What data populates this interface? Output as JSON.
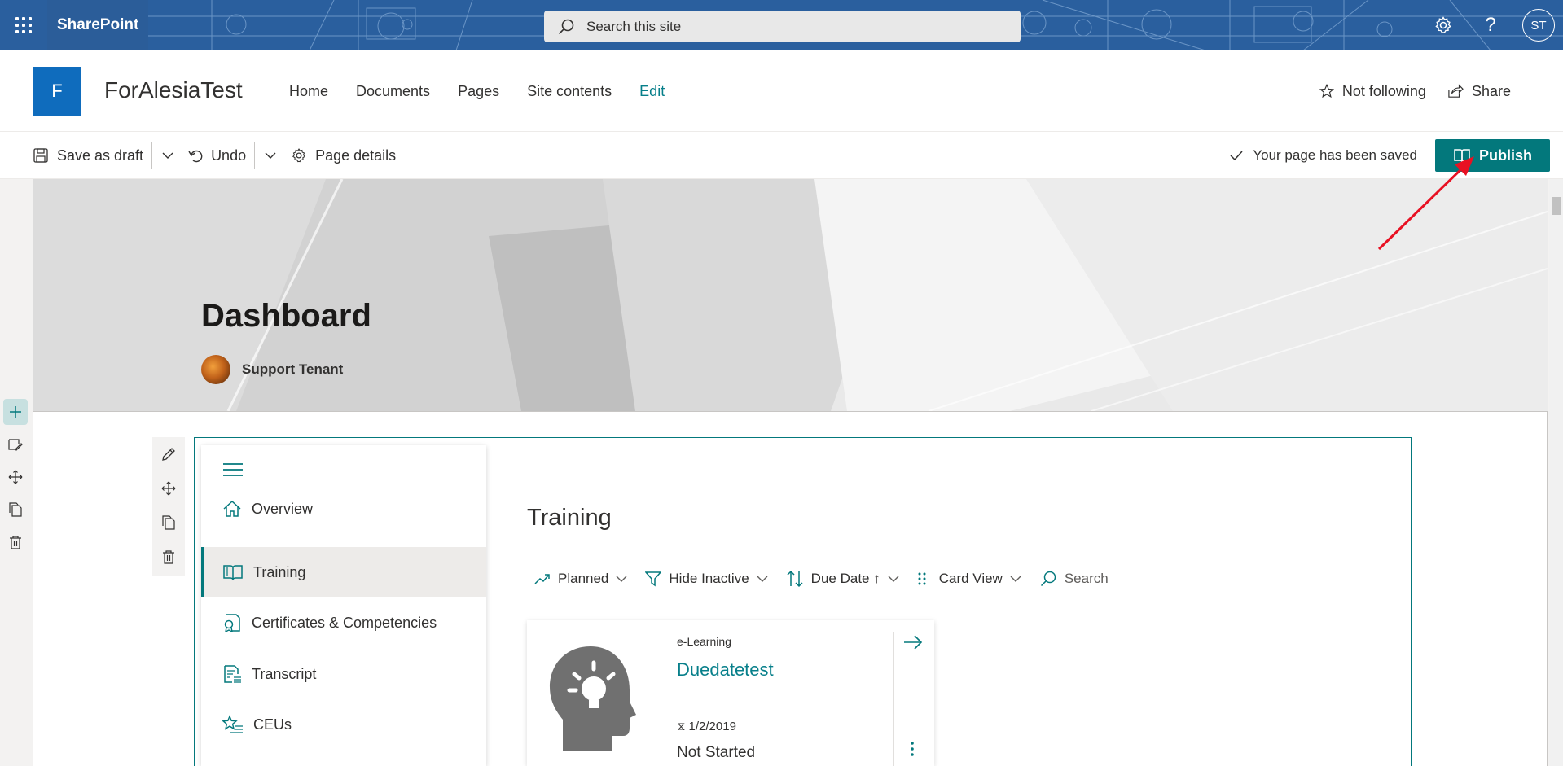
{
  "suite_bar": {
    "brand": "SharePoint",
    "search_placeholder": "Search this site",
    "user_initials": "ST",
    "icons": [
      "app-launcher-icon",
      "gear-icon",
      "help-icon"
    ]
  },
  "site_header": {
    "logo_letter": "F",
    "title": "ForAlesiaTest",
    "nav": [
      "Home",
      "Documents",
      "Pages",
      "Site contents",
      "Edit"
    ],
    "follow_label": "Not following",
    "share_label": "Share"
  },
  "command_bar": {
    "save_draft": "Save as draft",
    "undo": "Undo",
    "page_details": "Page details",
    "saved_status": "Your page has been saved",
    "publish": "Publish"
  },
  "hero": {
    "page_title": "Dashboard",
    "author": "Support Tenant"
  },
  "training_nav": {
    "items": [
      "Overview",
      "Training",
      "Certificates & Competencies",
      "Transcript",
      "CEUs"
    ],
    "active": "Training"
  },
  "training": {
    "title": "Training",
    "filters": {
      "planned": "Planned",
      "hide_inactive": "Hide Inactive",
      "due_date": "Due Date ↑",
      "card_view": "Card View",
      "search": "Search"
    },
    "card": {
      "type": "e-Learning",
      "title": "Duedatetest",
      "date": "1/2/2019",
      "status": "Not Started"
    }
  },
  "colors": {
    "suite_bar": "#2a5f9e",
    "accent_teal": "#03787c",
    "link_teal": "#077f8a",
    "site_logo": "#0f6cbd",
    "annotation_red": "#e81123"
  }
}
